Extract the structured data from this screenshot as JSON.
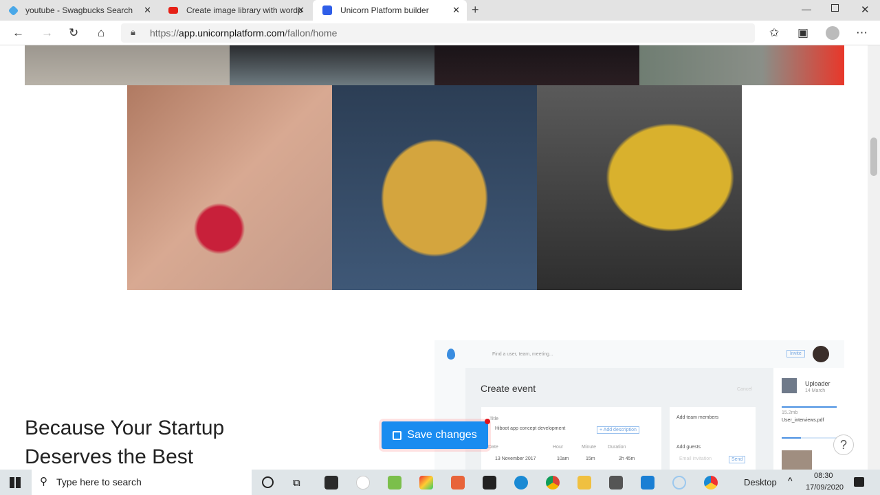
{
  "browser": {
    "tabs": [
      {
        "title": "youtube - Swagbucks Search",
        "active": false,
        "icon": "swagbucks-icon",
        "color": "#4aa8e8"
      },
      {
        "title": "Create image library with wordp",
        "active": false,
        "icon": "youtube-icon",
        "color": "#e62117"
      },
      {
        "title": "Unicorn Platform builder",
        "active": true,
        "icon": "unicorn-icon",
        "color": "#2f5ee8"
      }
    ],
    "url_prefix": "https://",
    "url_domain": "app.unicornplatform.com",
    "url_path": "/fallon/home"
  },
  "page": {
    "heading_line1": "Because Your Startup",
    "heading_line2": "Deserves the Best",
    "save_label": "Save changes",
    "help_label": "?",
    "dashboard": {
      "search_placeholder": "Find a user, team, meeting...",
      "invite": "Invite",
      "title": "Create event",
      "cancel": "Cancel",
      "field_title": "Title",
      "title_value": "Hiboot app concept development",
      "add_description": "+ Add description",
      "date_label": "Date",
      "date_value": "13 November 2017",
      "hour_label": "Hour",
      "hour_value": "10am",
      "minute_label": "Minute",
      "minute_value": "15m",
      "duration_label": "Duration",
      "duration_value": "2h 45m",
      "team_label": "Add team members",
      "guests_label": "Add guests",
      "email_placeholder": "Email invitation",
      "send": "Send",
      "uploader": "Uploader",
      "uploader_date": "14 March",
      "file_size": "15.2mb",
      "file_name": "User_interviews.pdf"
    }
  },
  "taskbar": {
    "search_placeholder": "Type here to search",
    "desktop": "Desktop",
    "time": "08:30",
    "date": "17/09/2020"
  }
}
